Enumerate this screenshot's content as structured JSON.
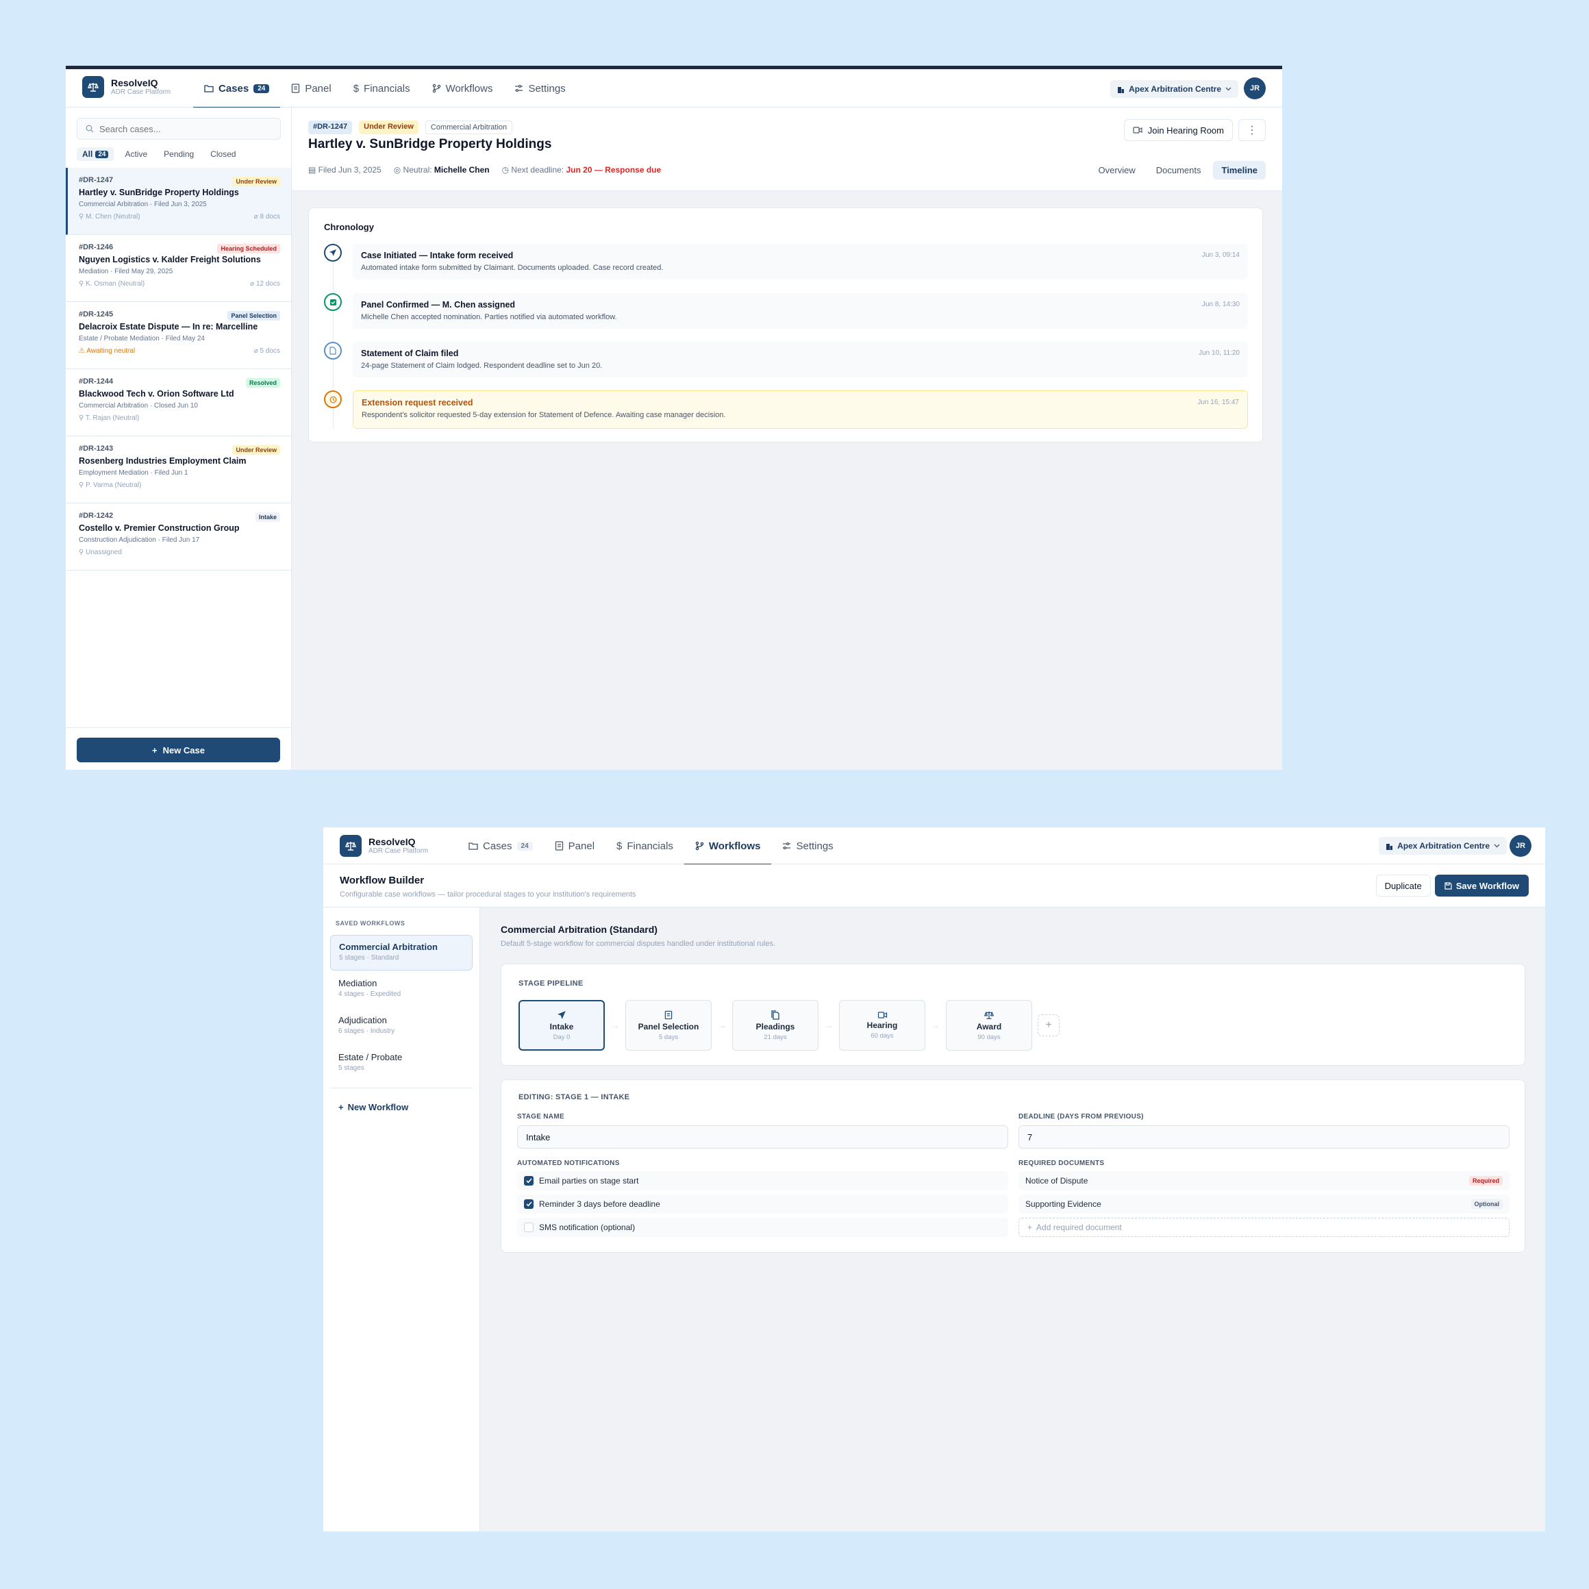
{
  "app": {
    "name": "ResolveIQ",
    "subtitle": "ADR Case Platform",
    "org": "Apex Arbitration Centre",
    "user_initials": "JR"
  },
  "nav": [
    {
      "label": "Cases",
      "badge": "24"
    },
    {
      "label": "Panel"
    },
    {
      "label": "Financials"
    },
    {
      "label": "Workflows"
    },
    {
      "label": "Settings"
    }
  ],
  "cases_view": {
    "search_placeholder": "Search cases...",
    "filters": [
      {
        "label": "All",
        "count": "24"
      },
      {
        "label": "Active"
      },
      {
        "label": "Pending"
      },
      {
        "label": "Closed"
      }
    ],
    "cases": [
      {
        "id": "#DR-1247",
        "status": "Under Review",
        "title": "Hartley v. SunBridge Property Holdings",
        "sub": "Commercial Arbitration · Filed Jun 3, 2025",
        "neutral": "M. Chen (Neutral)",
        "docs": "8 docs"
      },
      {
        "id": "#DR-1246",
        "status": "Hearing Scheduled",
        "title": "Nguyen Logistics v. Kalder Freight Solutions",
        "sub": "Mediation · Filed May 29, 2025",
        "neutral": "K. Osman (Neutral)",
        "docs": "12 docs"
      },
      {
        "id": "#DR-1245",
        "status": "Panel Selection",
        "title": "Delacroix Estate Dispute — In re: Marcelline",
        "sub": "Estate / Probate Mediation · Filed May 24",
        "neutral": "Awaiting neutral",
        "docs": "5 docs"
      },
      {
        "id": "#DR-1244",
        "status": "Resolved",
        "title": "Blackwood Tech v. Orion Software Ltd",
        "sub": "Commercial Arbitration · Closed Jun 10",
        "neutral": "T. Rajan (Neutral)",
        "docs": ""
      },
      {
        "id": "#DR-1243",
        "status": "Under Review",
        "title": "Rosenberg Industries Employment Claim",
        "sub": "Employment Mediation · Filed Jun 1",
        "neutral": "P. Varma (Neutral)",
        "docs": ""
      },
      {
        "id": "#DR-1242",
        "status": "Intake",
        "title": "Costello v. Premier Construction Group",
        "sub": "Construction Adjudication · Filed Jun 17",
        "neutral": "Unassigned",
        "docs": ""
      }
    ],
    "new_case": "New Case",
    "detail": {
      "id": "#DR-1247",
      "status": "Under Review",
      "type": "Commercial Arbitration",
      "title": "Hartley v. SunBridge Property Holdings",
      "filed": "Filed Jun 3, 2025",
      "neutral_label": "Neutral:",
      "neutral": "Michelle Chen",
      "deadline_label": "Next deadline:",
      "deadline": "Jun 20 — Response due",
      "join": "Join Hearing Room",
      "tabs": [
        "Overview",
        "Documents",
        "Timeline"
      ],
      "chronology_title": "Chronology",
      "events": [
        {
          "title": "Case Initiated — Intake form received",
          "desc": "Automated intake form submitted by Claimant. Documents uploaded. Case record created.",
          "time": "Jun 3, 09:14"
        },
        {
          "title": "Panel Confirmed — M. Chen assigned",
          "desc": "Michelle Chen accepted nomination. Parties notified via automated workflow.",
          "time": "Jun 8, 14:30"
        },
        {
          "title": "Statement of Claim filed",
          "desc": "24-page Statement of Claim lodged. Respondent deadline set to Jun 20.",
          "time": "Jun 10, 11:20"
        },
        {
          "title": "Extension request received",
          "desc": "Respondent's solicitor requested 5-day extension for Statement of Defence. Awaiting case manager decision.",
          "time": "Jun 16, 15:47"
        }
      ]
    }
  },
  "workflow_view": {
    "title": "Workflow Builder",
    "subtitle": "Configurable case workflows — tailor procedural stages to your institution's requirements",
    "duplicate": "Duplicate",
    "save": "Save Workflow",
    "saved_heading": "SAVED WORKFLOWS",
    "saved": [
      {
        "name": "Commercial Arbitration",
        "meta": "5 stages · Standard"
      },
      {
        "name": "Mediation",
        "meta": "4 stages · Expedited"
      },
      {
        "name": "Adjudication",
        "meta": "6 stages · Industry"
      },
      {
        "name": "Estate / Probate",
        "meta": "5 stages"
      }
    ],
    "new_workflow": "New Workflow",
    "current_title": "Commercial Arbitration (Standard)",
    "current_desc": "Default 5-stage workflow for commercial disputes handled under institutional rules.",
    "pipeline_heading": "STAGE PIPELINE",
    "stages": [
      {
        "name": "Intake",
        "days": "Day 0"
      },
      {
        "name": "Panel Selection",
        "days": "5 days"
      },
      {
        "name": "Pleadings",
        "days": "21 days"
      },
      {
        "name": "Hearing",
        "days": "60 days"
      },
      {
        "name": "Award",
        "days": "90 days"
      }
    ],
    "editing_heading": "EDITING: STAGE 1 — INTAKE",
    "stage_name_label": "STAGE NAME",
    "stage_name": "Intake",
    "deadline_label": "DEADLINE (DAYS FROM PREVIOUS)",
    "deadline": "7",
    "notif_label": "AUTOMATED NOTIFICATIONS",
    "notifications": [
      {
        "label": "Email parties on stage start",
        "checked": true
      },
      {
        "label": "Reminder 3 days before deadline",
        "checked": true
      },
      {
        "label": "SMS notification (optional)",
        "checked": false
      }
    ],
    "docs_label": "REQUIRED DOCUMENTS",
    "documents": [
      {
        "name": "Notice of Dispute",
        "tag": "Required"
      },
      {
        "name": "Supporting Evidence",
        "tag": "Optional"
      }
    ],
    "add_doc": "Add required document"
  }
}
